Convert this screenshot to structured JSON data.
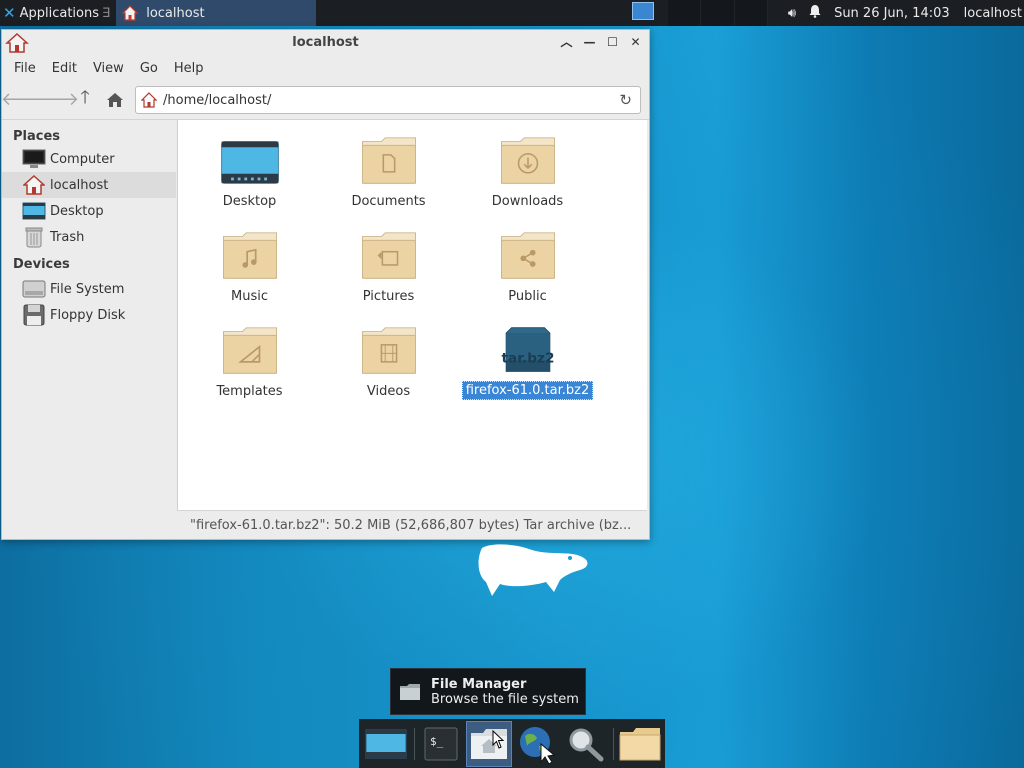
{
  "top_panel": {
    "applications_label": "Applications",
    "task_label": "localhost",
    "clock": "Sun 26 Jun, 14:03",
    "user": "localhost"
  },
  "window": {
    "title": "localhost",
    "menu": [
      "File",
      "Edit",
      "View",
      "Go",
      "Help"
    ],
    "address": "/home/localhost/",
    "sidebar": {
      "places_header": "Places",
      "places": [
        {
          "label": "Computer",
          "icon": "computer-icon"
        },
        {
          "label": "localhost",
          "icon": "home-icon",
          "selected": true
        },
        {
          "label": "Desktop",
          "icon": "desktop-icon"
        },
        {
          "label": "Trash",
          "icon": "trash-icon"
        }
      ],
      "devices_header": "Devices",
      "devices": [
        {
          "label": "File System",
          "icon": "drive-icon"
        },
        {
          "label": "Floppy Disk",
          "icon": "floppy-icon"
        }
      ]
    },
    "files": [
      {
        "label": "Desktop",
        "icon": "desktop-folder-icon"
      },
      {
        "label": "Documents",
        "icon": "documents-folder-icon"
      },
      {
        "label": "Downloads",
        "icon": "downloads-folder-icon"
      },
      {
        "label": "Music",
        "icon": "music-folder-icon"
      },
      {
        "label": "Pictures",
        "icon": "pictures-folder-icon"
      },
      {
        "label": "Public",
        "icon": "public-folder-icon"
      },
      {
        "label": "Templates",
        "icon": "templates-folder-icon"
      },
      {
        "label": "Videos",
        "icon": "videos-folder-icon"
      },
      {
        "label": "firefox-61.0.tar.bz2",
        "icon": "archive-icon",
        "selected": true,
        "badge": "tar.bz2"
      }
    ],
    "status": "\"firefox-61.0.tar.bz2\": 50.2 MiB (52,686,807 bytes) Tar archive (bz..."
  },
  "tooltip": {
    "title": "File Manager",
    "subtitle": "Browse the file system"
  },
  "colors": {
    "selection": "#3a86d6",
    "folder": "#e9cfa0",
    "desktop_bg": "#1693c9"
  }
}
